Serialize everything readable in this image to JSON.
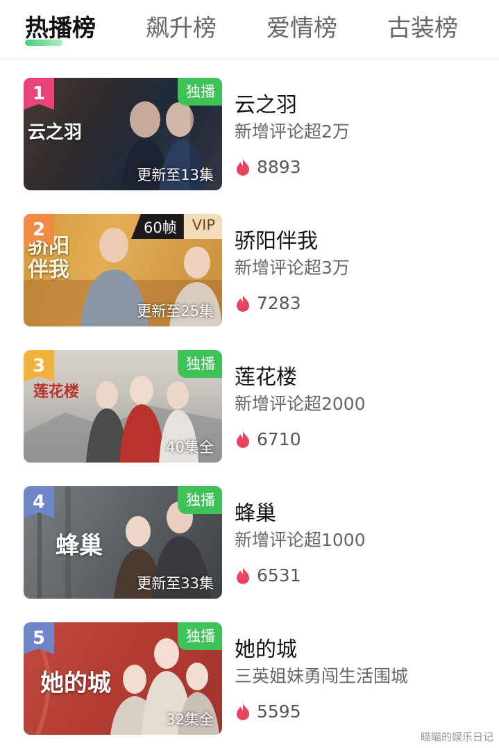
{
  "tabs": [
    "热播榜",
    "飙升榜",
    "爱情榜",
    "古装榜"
  ],
  "colors": {
    "accent": "#3cc255",
    "heat": "#e8435f"
  },
  "items": [
    {
      "rank": "1",
      "title": "云之羽",
      "subtitle": "新增评论超2万",
      "heat": "8893",
      "badge": "独播",
      "episodes": "更新至13集",
      "logo": "云之羽",
      "rank_color": "#e8437d"
    },
    {
      "rank": "2",
      "title": "骄阳伴我",
      "subtitle": "新增评论超3万",
      "heat": "7283",
      "fps": "60帧",
      "vip": "VIP",
      "episodes": "更新至25集",
      "logo": "骄阳伴我",
      "rank_color": "#f08a44"
    },
    {
      "rank": "3",
      "title": "莲花楼",
      "subtitle": "新增评论超2000",
      "heat": "6710",
      "badge": "独播",
      "episodes": "40集全",
      "logo": "莲花楼",
      "rank_color": "#f3b23c"
    },
    {
      "rank": "4",
      "title": "蜂巢",
      "subtitle": "新增评论超1000",
      "heat": "6531",
      "badge": "独播",
      "episodes": "更新至33集",
      "logo": "蜂巢",
      "rank_color": "#6f86c8"
    },
    {
      "rank": "5",
      "title": "她的城",
      "subtitle": "三英姐妹勇闯生活围城",
      "heat": "5595",
      "badge": "独播",
      "episodes": "32集全",
      "logo": "她的城",
      "rank_color": "#6f86c8"
    }
  ],
  "watermark": "瞄瞄的娱乐日记"
}
